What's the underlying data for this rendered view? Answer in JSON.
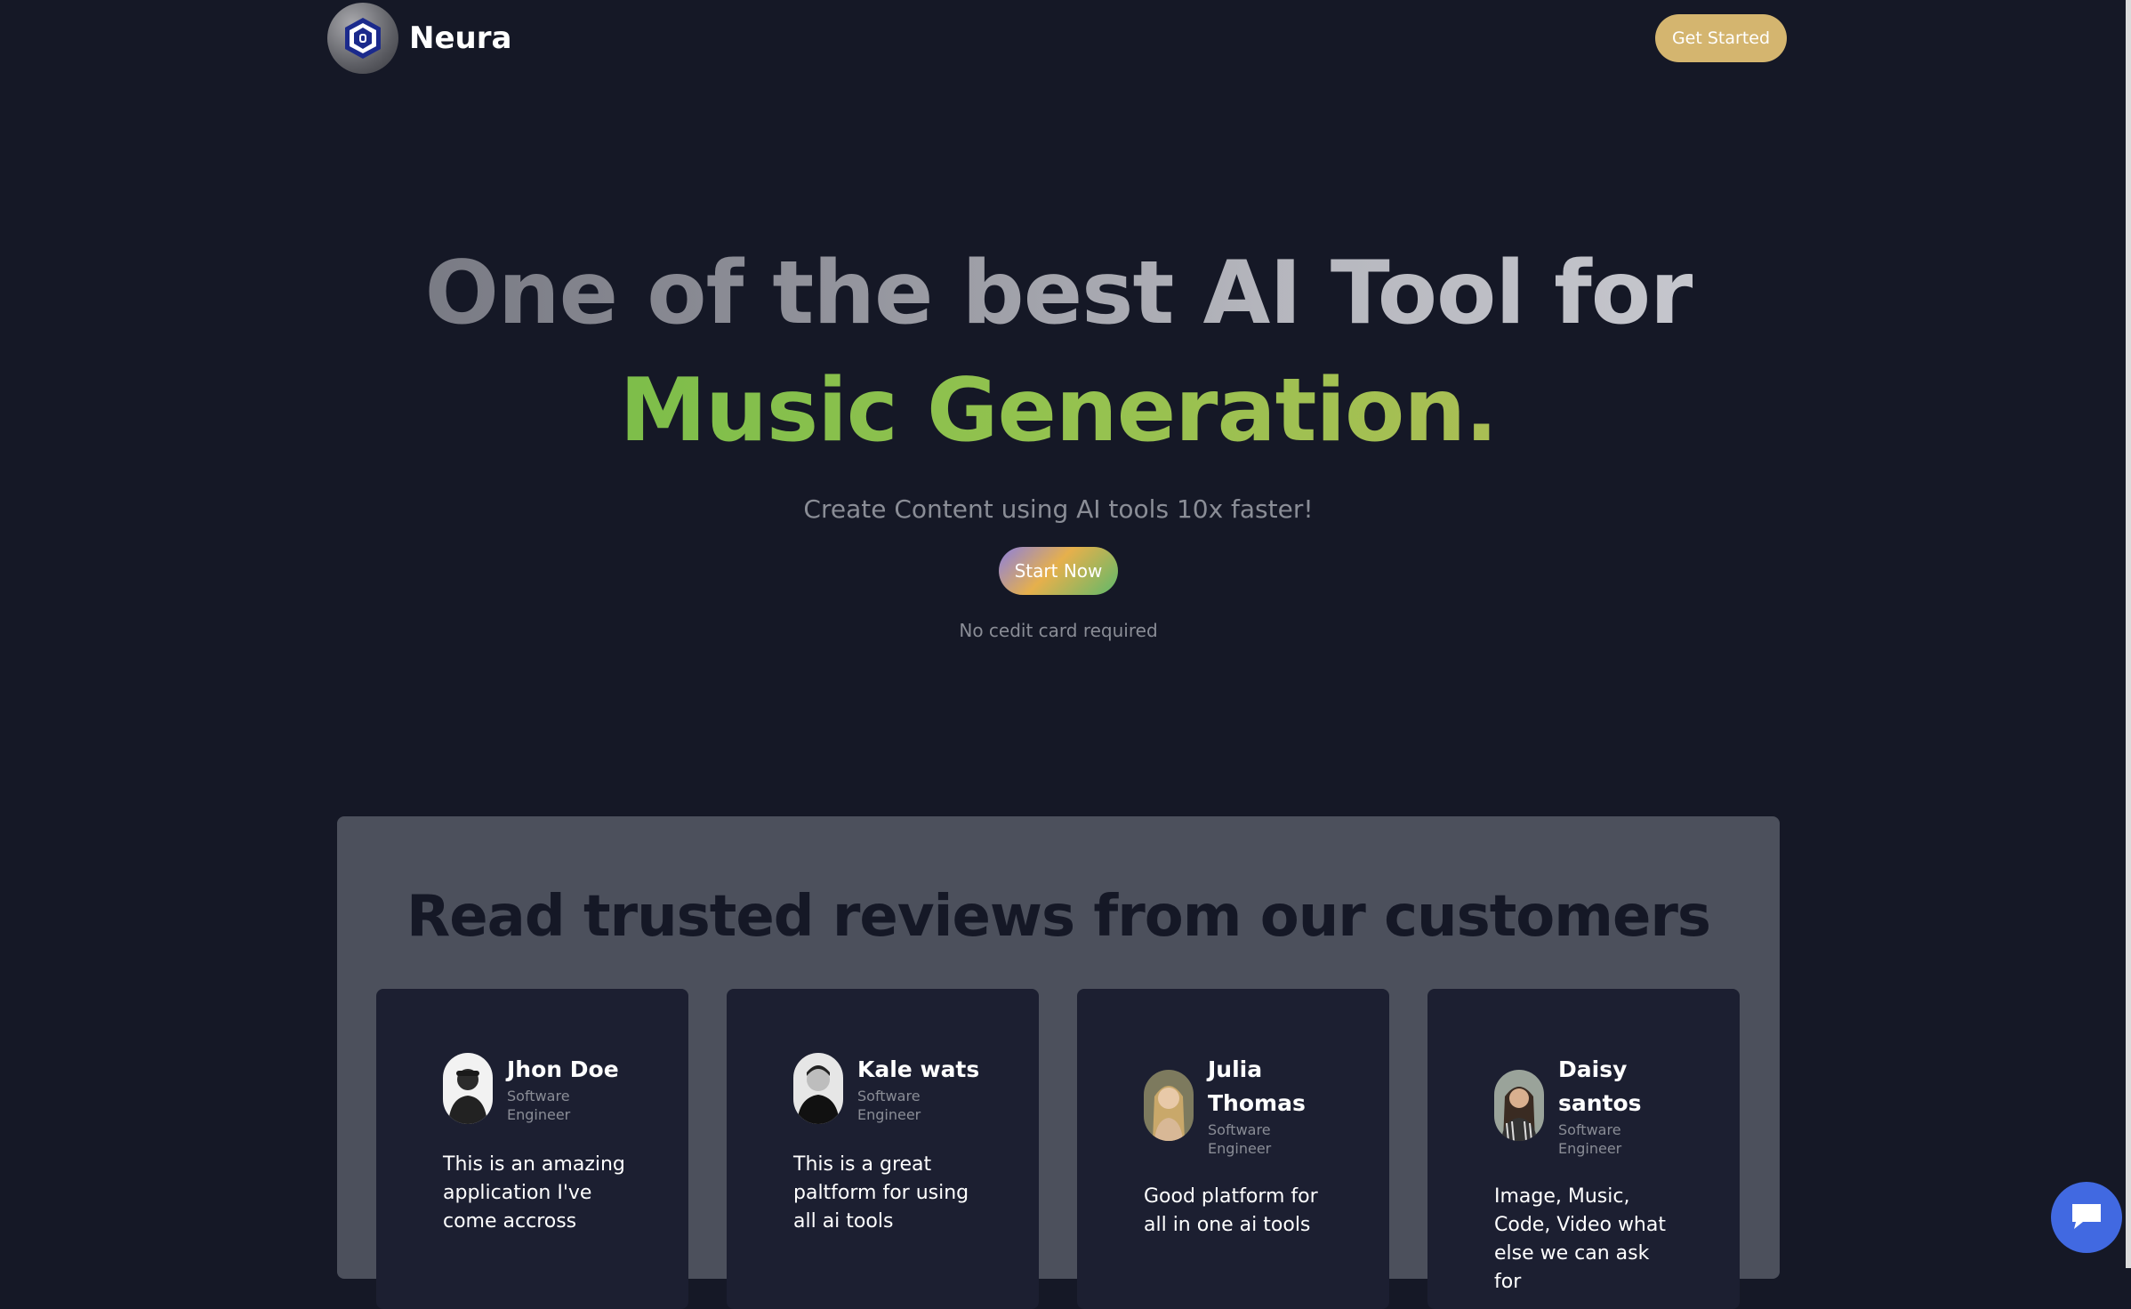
{
  "brand": {
    "name": "Neura"
  },
  "header": {
    "cta_label": "Get Started"
  },
  "hero": {
    "title_line1": "One of the best AI Tool for",
    "title_line2": "Music Generation.",
    "subtitle": "Create Content using AI tools 10x faster!",
    "cta_label": "Start Now",
    "note": "No cedit card required"
  },
  "reviews": {
    "title": "Read trusted reviews from our customers",
    "cards": [
      {
        "name": "Jhon Doe",
        "role": "Software Engineer",
        "quote": "This is an amazing application I've come accross"
      },
      {
        "name": "Kale wats",
        "role": "Software Engineer",
        "quote": "This is a great paltform for using all ai tools"
      },
      {
        "name": "Julia Thomas",
        "role": "Software Engineer",
        "quote": "Good platform for all in one ai tools"
      },
      {
        "name": "Daisy santos",
        "role": "Software Engineer",
        "quote": "Image, Music, Code, Video what else we can ask for"
      }
    ]
  },
  "colors": {
    "background": "#151826",
    "accent_gold": "#d4b56f",
    "accent_green": "#5db843",
    "panel": "#4c505c",
    "card": "#1c1f31",
    "chat_blue": "#4169e1"
  },
  "icons": {
    "logo": "hexagon-shield-logo-icon",
    "chat": "chat-bubble-icon"
  }
}
